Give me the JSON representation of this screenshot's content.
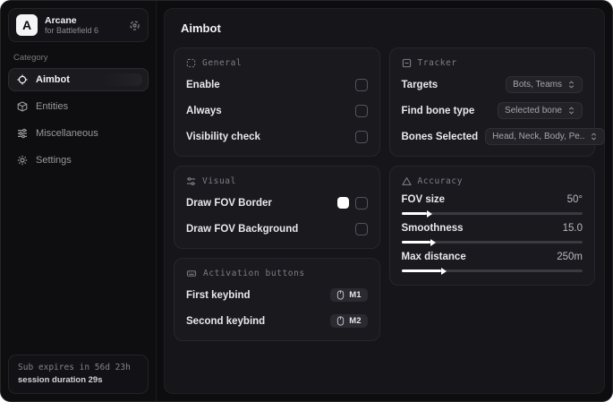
{
  "app": {
    "name": "Arcane",
    "subtitle": "for Battlefield 6",
    "logo_letter": "A"
  },
  "sidebar": {
    "category_label": "Category",
    "items": [
      {
        "label": "Aimbot",
        "icon": "crosshair-icon",
        "active": true
      },
      {
        "label": "Entities",
        "icon": "cube-icon",
        "active": false
      },
      {
        "label": "Miscellaneous",
        "icon": "sliders-icon",
        "active": false
      },
      {
        "label": "Settings",
        "icon": "gear-icon",
        "active": false
      }
    ],
    "footer": {
      "sub_expires": "Sub expires in 56d 23h",
      "session_duration": "session duration 29s"
    }
  },
  "main": {
    "title": "Aimbot",
    "general": {
      "title": "General",
      "rows": [
        {
          "label": "Enable",
          "checked": false
        },
        {
          "label": "Always",
          "checked": false
        },
        {
          "label": "Visibility check",
          "checked": false
        }
      ]
    },
    "visual": {
      "title": "Visual",
      "rows": [
        {
          "label": "Draw FOV Border",
          "swatch": "#ffffff",
          "checked": false
        },
        {
          "label": "Draw FOV Background",
          "checked": false
        }
      ]
    },
    "activation": {
      "title": "Activation buttons",
      "rows": [
        {
          "label": "First keybind",
          "key": "M1"
        },
        {
          "label": "Second keybind",
          "key": "M2"
        }
      ]
    },
    "tracker": {
      "title": "Tracker",
      "rows": [
        {
          "label": "Targets",
          "value": "Bots, Teams"
        },
        {
          "label": "Find bone type",
          "value": "Selected bone"
        },
        {
          "label": "Bones Selected",
          "value": "Head, Neck, Body, Pe.."
        }
      ]
    },
    "accuracy": {
      "title": "Accuracy",
      "sliders": [
        {
          "label": "FOV size",
          "value": "50°",
          "fill_pct": 14
        },
        {
          "label": "Smoothness",
          "value": "15.0",
          "fill_pct": 16
        },
        {
          "label": "Max distance",
          "value": "250m",
          "fill_pct": 22
        }
      ]
    }
  },
  "colors": {
    "accent": "#ffffff",
    "panel_bg": "#15151a",
    "card_bg": "#19191e",
    "sidebar_bg": "#0e0e11"
  }
}
